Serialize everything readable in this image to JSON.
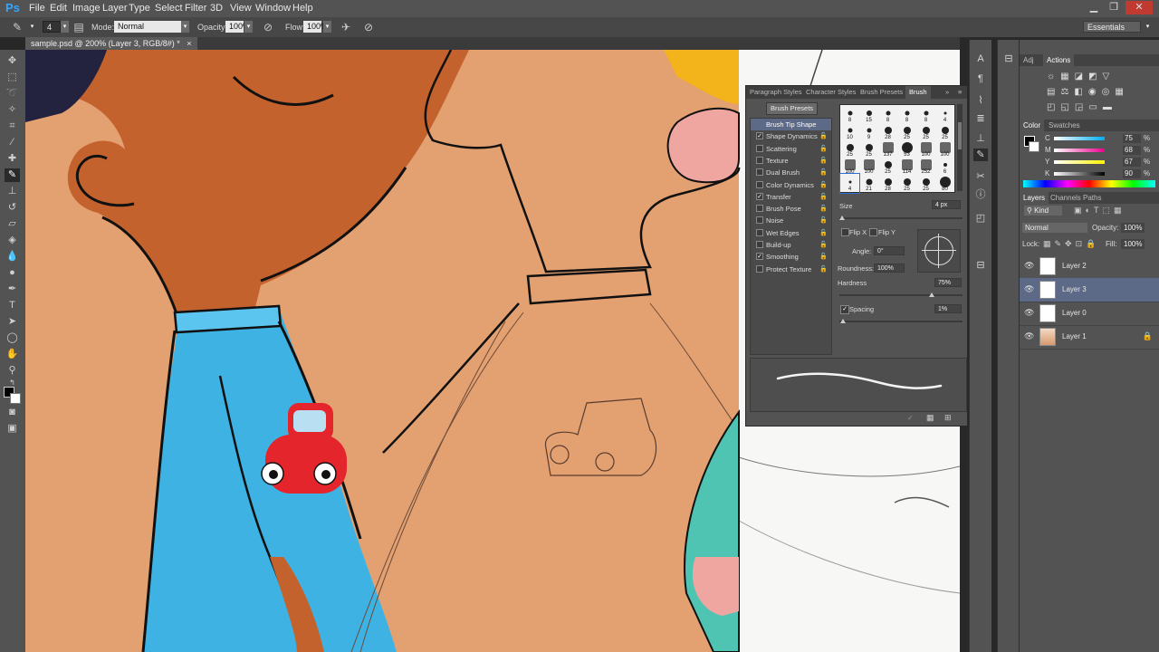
{
  "app": {
    "logo": "Ps"
  },
  "menubar": {
    "items": [
      "File",
      "Edit",
      "Image",
      "Layer",
      "Type",
      "Select",
      "Filter",
      "3D",
      "View",
      "Window",
      "Help"
    ],
    "workspace": "Essentials"
  },
  "options_bar": {
    "brush_size": "4",
    "mode_label": "Mode:",
    "mode_value": "Normal",
    "opacity_label": "Opacity:",
    "opacity_value": "100%",
    "flow_label": "Flow:",
    "flow_value": "100%"
  },
  "document": {
    "tab_title": "sample.psd @ 200% (Layer 3, RGB/8#) *",
    "close": "×"
  },
  "brush_panel": {
    "tabs": [
      "Paragraph Styles",
      "Character Styles",
      "Brush Presets",
      "Brush"
    ],
    "selected_tab": "Brush",
    "presets_button": "Brush Presets",
    "options": [
      {
        "label": "Brush Tip Shape",
        "checked": null,
        "selected": true
      },
      {
        "label": "Shape Dynamics",
        "checked": true
      },
      {
        "label": "Scattering",
        "checked": false
      },
      {
        "label": "Texture",
        "checked": false
      },
      {
        "label": "Dual Brush",
        "checked": false
      },
      {
        "label": "Color Dynamics",
        "checked": false
      },
      {
        "label": "Transfer",
        "checked": true
      },
      {
        "label": "Brush Pose",
        "checked": false
      },
      {
        "label": "Noise",
        "checked": false
      },
      {
        "label": "Wet Edges",
        "checked": false
      },
      {
        "label": "Build-up",
        "checked": false
      },
      {
        "label": "Smoothing",
        "checked": true
      },
      {
        "label": "Protect Texture",
        "checked": false
      }
    ],
    "tip_sizes": [
      "8",
      "15",
      "8",
      "8",
      "8",
      "4",
      "10",
      "9",
      "28",
      "25",
      "25",
      "25",
      "25",
      "25",
      "137",
      "53",
      "100",
      "100",
      "100",
      "100",
      "25",
      "114",
      "252",
      "6",
      "4",
      "21",
      "28",
      "25",
      "25",
      "80"
    ],
    "size_label": "Size",
    "size_value": "4 px",
    "flip_x": "Flip X",
    "flip_y": "Flip Y",
    "angle_label": "Angle:",
    "angle_value": "0°",
    "roundness_label": "Roundness:",
    "roundness_value": "100%",
    "hardness_label": "Hardness",
    "hardness_value": "75%",
    "hardness_level": 0.75,
    "spacing_label": "Spacing",
    "spacing_value": "1%",
    "spacing_checked": true
  },
  "right_panel": {
    "top_tabs": [
      "Adj",
      "Actions"
    ],
    "color_tabs": [
      "Color",
      "Swatches"
    ],
    "cmyk": [
      {
        "label": "C",
        "value": "75",
        "unit": "%"
      },
      {
        "label": "M",
        "value": "68",
        "unit": "%"
      },
      {
        "label": "Y",
        "value": "67",
        "unit": "%"
      },
      {
        "label": "K",
        "value": "90",
        "unit": "%"
      }
    ],
    "layer_tabs": [
      "Layers",
      "Channels",
      "Paths"
    ],
    "kind_label": "Kind",
    "blend_mode": "Normal",
    "opacity_label": "Opacity:",
    "opacity_value": "100%",
    "lock_label": "Lock:",
    "fill_label": "Fill:",
    "fill_value": "100%",
    "layers": [
      {
        "name": "Layer 2",
        "selected": false,
        "locked": false
      },
      {
        "name": "Layer 3",
        "selected": true,
        "locked": false
      },
      {
        "name": "Layer 0",
        "selected": false,
        "locked": false
      },
      {
        "name": "Layer 1",
        "selected": false,
        "locked": true
      }
    ]
  },
  "colors": {
    "accent": "#31a8ff",
    "canvas_bg": "#e3a070",
    "shirt_blue": "#3eb3e3",
    "teal": "#4fc4b3",
    "selection": "#5c6a88"
  }
}
